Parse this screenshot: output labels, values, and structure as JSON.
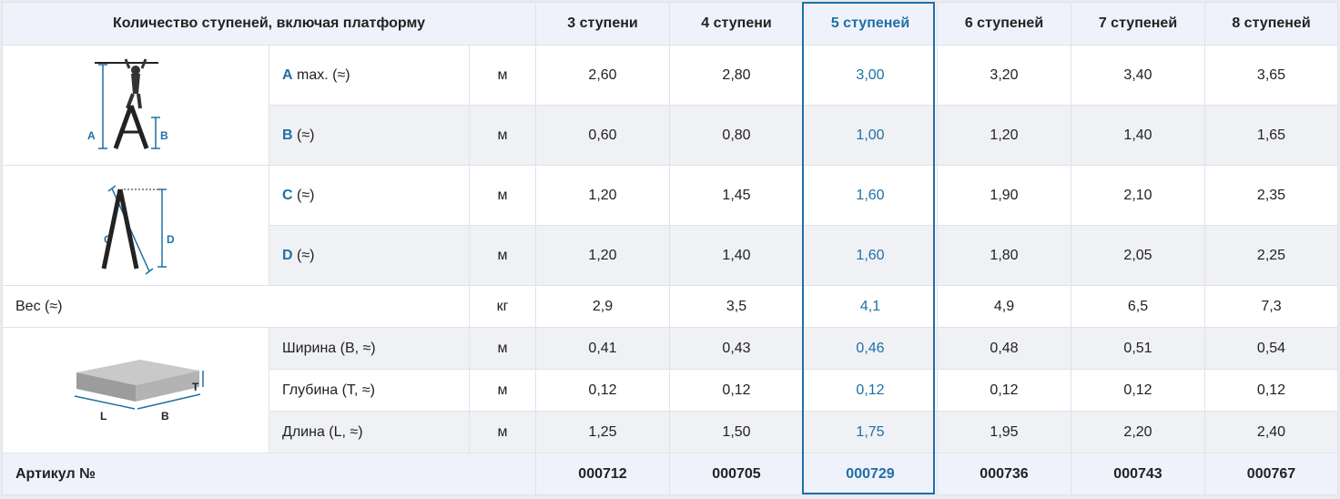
{
  "header": {
    "title": "Количество ступеней, включая платформу",
    "columns": [
      "3 ступени",
      "4 ступени",
      "5 ступеней",
      "6 ступеней",
      "7 ступеней",
      "8 ступеней"
    ]
  },
  "rows": {
    "a": {
      "key": "A",
      "label": " max. (≈)",
      "unit": "м",
      "values": [
        "2,60",
        "2,80",
        "3,00",
        "3,20",
        "3,40",
        "3,65"
      ]
    },
    "b": {
      "key": "B",
      "label": " (≈)",
      "unit": "м",
      "values": [
        "0,60",
        "0,80",
        "1,00",
        "1,20",
        "1,40",
        "1,65"
      ]
    },
    "c": {
      "key": "C",
      "label": " (≈)",
      "unit": "м",
      "values": [
        "1,20",
        "1,45",
        "1,60",
        "1,90",
        "2,10",
        "2,35"
      ]
    },
    "d": {
      "key": "D",
      "label": " (≈)",
      "unit": "м",
      "values": [
        "1,20",
        "1,40",
        "1,60",
        "1,80",
        "2,05",
        "2,25"
      ]
    },
    "weight": {
      "label": "Вес (≈)",
      "unit": "кг",
      "values": [
        "2,9",
        "3,5",
        "4,1",
        "4,9",
        "6,5",
        "7,3"
      ]
    },
    "width": {
      "label": "Ширина (B, ≈)",
      "unit": "м",
      "values": [
        "0,41",
        "0,43",
        "0,46",
        "0,48",
        "0,51",
        "0,54"
      ]
    },
    "depth": {
      "label": "Глубина (T, ≈)",
      "unit": "м",
      "values": [
        "0,12",
        "0,12",
        "0,12",
        "0,12",
        "0,12",
        "0,12"
      ]
    },
    "length": {
      "label": "Длина (L, ≈)",
      "unit": "м",
      "values": [
        "1,25",
        "1,50",
        "1,75",
        "1,95",
        "2,20",
        "2,40"
      ]
    },
    "article": {
      "label": "Артикул №",
      "values": [
        "000712",
        "000705",
        "000729",
        "000736",
        "000743",
        "000767"
      ]
    }
  },
  "diagram_letters": {
    "ladder_open": [
      "A",
      "B"
    ],
    "ladder_folded": [
      "C",
      "D"
    ],
    "package": [
      "T",
      "L",
      "B"
    ]
  },
  "highlight_color": "#1f6fa6"
}
